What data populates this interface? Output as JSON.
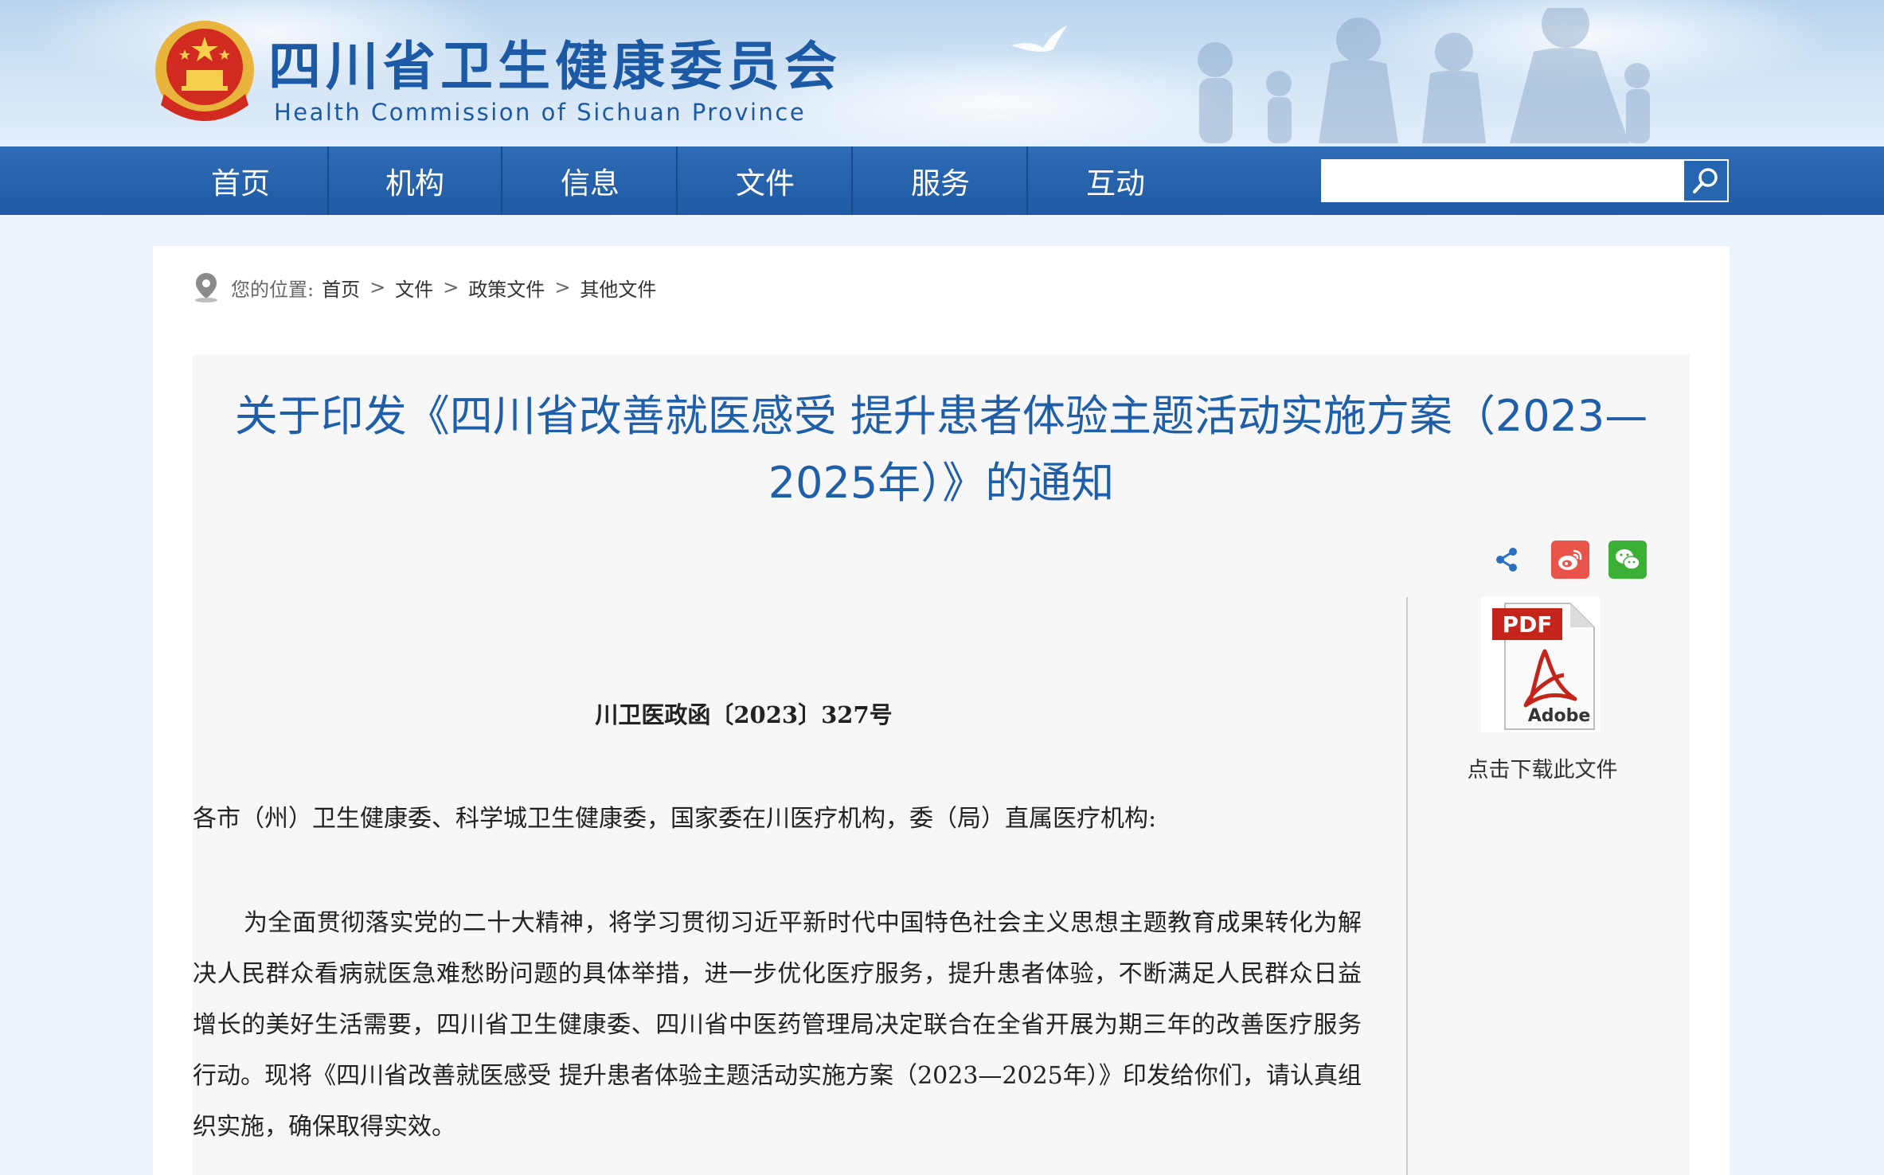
{
  "site": {
    "title": "四川省卫生健康委员会",
    "subtitle": "Health Commission of Sichuan Province"
  },
  "nav": {
    "items": [
      {
        "label": "首页"
      },
      {
        "label": "机构"
      },
      {
        "label": "信息"
      },
      {
        "label": "文件"
      },
      {
        "label": "服务"
      },
      {
        "label": "互动"
      }
    ],
    "search_value": "",
    "search_icon": "magnifier-icon"
  },
  "breadcrumb": {
    "label": "您的位置:",
    "items": [
      "首页",
      "文件",
      "政策文件",
      "其他文件"
    ],
    "separator": ">"
  },
  "article": {
    "title": "关于印发《四川省改善就医感受 提升患者体验主题活动实施方案（2023—2025年）》的通知",
    "doc_number": "川卫医政函〔2023〕327号",
    "addressee": "各市（州）卫生健康委、科学城卫生健康委，国家委在川医疗机构，委（局）直属医疗机构:",
    "body": "为全面贯彻落实党的二十大精神，将学习贯彻习近平新时代中国特色社会主义思想主题教育成果转化为解决人民群众看病就医急难愁盼问题的具体举措，进一步优化医疗服务，提升患者体验，不断满足人民群众日益增长的美好生活需要，四川省卫生健康委、四川省中医药管理局决定联合在全省开展为期三年的改善医疗服务行动。现将《四川省改善就医感受 提升患者体验主题活动实施方案（2023—2025年）》印发给你们，请认真组织实施，确保取得实效。"
  },
  "share": {
    "icons": [
      "share-icon",
      "weibo-icon",
      "wechat-icon"
    ]
  },
  "download": {
    "pdf_text": "PDF",
    "brand_text": "Adobe",
    "label": "点击下载此文件"
  },
  "colors": {
    "brand_blue": "#1f5ea8",
    "nav_blue": "#2466b0",
    "weibo": "#e8534a",
    "wechat": "#3cb034"
  }
}
